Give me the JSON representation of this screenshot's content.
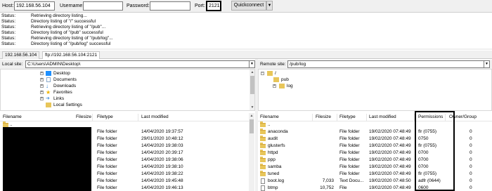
{
  "quickconnect": {
    "host_label": "Host:",
    "host_value": "192.168.56.104",
    "username_label": "Username:",
    "username_value": "",
    "password_label": "Password:",
    "password_value": "",
    "port_label": "Port:",
    "port_value": "2121",
    "connect_label": "Quickconnect",
    "dropdown_glyph": "▼"
  },
  "log": [
    {
      "key": "Status:",
      "value": "Retrieving directory listing..."
    },
    {
      "key": "Status:",
      "value": "Directory listing of \"/\" successful"
    },
    {
      "key": "Status:",
      "value": "Retrieving directory listing of \"/pub\"..."
    },
    {
      "key": "Status:",
      "value": "Directory listing of \"/pub\" successful"
    },
    {
      "key": "Status:",
      "value": "Retrieving directory listing of \"/pub/log\"..."
    },
    {
      "key": "Status:",
      "value": "Directory listing of \"/pub/log\" successful"
    }
  ],
  "tabs": [
    {
      "label": "192.168.56.104",
      "active": false
    },
    {
      "label": "ftp://192.168.56.104:2121",
      "active": true
    }
  ],
  "local": {
    "site_label": "Local site:",
    "site_path": "C:\\Users\\ADMIN\\Desktop\\",
    "tree": [
      {
        "label": "Desktop",
        "icon": "desktop-icon",
        "color": "#1e90ff"
      },
      {
        "label": "Documents",
        "icon": "documents-icon",
        "color": "#8aa8c8"
      },
      {
        "label": "Downloads",
        "icon": "downloads-icon",
        "color": "#2a7fd4"
      },
      {
        "label": "Favorites",
        "icon": "star-icon",
        "color": "#f0b400"
      },
      {
        "label": "Links",
        "icon": "links-icon",
        "color": "#4a90d9"
      },
      {
        "label": "Local Settings",
        "icon": "folder-icon",
        "color": "#e8c65a"
      }
    ],
    "columns": {
      "filename": "Filename",
      "filesize": "Filesize",
      "filetype": "Filetype",
      "modified": "Last modified"
    },
    "rows": [
      {
        "name": "..",
        "size": "",
        "type": "",
        "modified": ""
      },
      {
        "name": "",
        "size": "",
        "type": "File folder",
        "modified": "14/04/2020 19:37:57"
      },
      {
        "name": "",
        "size": "",
        "type": "File folder",
        "modified": "29/01/2020 10:48:12"
      },
      {
        "name": "",
        "size": "",
        "type": "File folder",
        "modified": "14/04/2020 19:38:03"
      },
      {
        "name": "",
        "size": "",
        "type": "File folder",
        "modified": "14/04/2020 20:39:17"
      },
      {
        "name": "",
        "size": "",
        "type": "File folder",
        "modified": "14/04/2020 19:38:06"
      },
      {
        "name": "",
        "size": "",
        "type": "File folder",
        "modified": "14/04/2020 19:38:10"
      },
      {
        "name": "",
        "size": "",
        "type": "File folder",
        "modified": "14/04/2020 19:38:22"
      },
      {
        "name": "",
        "size": "",
        "type": "File folder",
        "modified": "14/04/2020 19:45:48"
      },
      {
        "name": "",
        "size": "",
        "type": "File folder",
        "modified": "14/04/2020 19:46:13"
      }
    ]
  },
  "remote": {
    "site_label": "Remote site:",
    "site_path": "/pub/log",
    "tree": [
      {
        "label": "/",
        "level": 0,
        "expander": "−"
      },
      {
        "label": "pub",
        "level": 1,
        "expander": ""
      },
      {
        "label": "log",
        "level": 2,
        "expander": "+"
      }
    ],
    "columns": {
      "filename": "Filename",
      "filesize": "Filesize",
      "filetype": "Filetype",
      "modified": "Last modified",
      "permissions": "Permissions",
      "owner": "Owner/Group"
    },
    "rows": [
      {
        "name": "..",
        "size": "",
        "type": "",
        "modified": "",
        "perms": "",
        "owner": "",
        "kind": "folder"
      },
      {
        "name": "anaconda",
        "size": "",
        "type": "File folder",
        "modified": "19/02/2020 07:48:49",
        "perms": "flr (0755)",
        "owner": "0",
        "kind": "folder"
      },
      {
        "name": "audit",
        "size": "",
        "type": "File folder",
        "modified": "19/02/2020 07:48:49",
        "perms": "0750",
        "owner": "0",
        "kind": "folder"
      },
      {
        "name": "glusterfs",
        "size": "",
        "type": "File folder",
        "modified": "19/02/2020 07:48:49",
        "perms": "flr (0755)",
        "owner": "0",
        "kind": "folder"
      },
      {
        "name": "httpd",
        "size": "",
        "type": "File folder",
        "modified": "19/02/2020 07:48:49",
        "perms": "0700",
        "owner": "0",
        "kind": "folder"
      },
      {
        "name": "ppp",
        "size": "",
        "type": "File folder",
        "modified": "19/02/2020 07:48:49",
        "perms": "0700",
        "owner": "0",
        "kind": "folder"
      },
      {
        "name": "samba",
        "size": "",
        "type": "File folder",
        "modified": "19/02/2020 07:48:49",
        "perms": "0700",
        "owner": "0",
        "kind": "folder"
      },
      {
        "name": "tuned",
        "size": "",
        "type": "File folder",
        "modified": "19/02/2020 07:48:49",
        "perms": "flr (0755)",
        "owner": "0",
        "kind": "folder"
      },
      {
        "name": "boot.log",
        "size": "7,033",
        "type": "Text Docu...",
        "modified": "19/02/2020 07:48:50",
        "perms": "adfr (0644)",
        "owner": "0",
        "kind": "file"
      },
      {
        "name": "btmp",
        "size": "10,752",
        "type": "File",
        "modified": "19/02/2020 07:48:49",
        "perms": "0600",
        "owner": "0",
        "kind": "file"
      }
    ]
  }
}
